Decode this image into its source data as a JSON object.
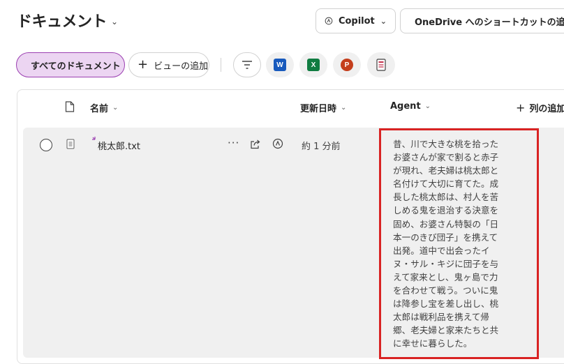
{
  "header": {
    "title": "ドキュメント",
    "copilot_label": "Copilot",
    "onedrive_label": "OneDrive へのショートカットの追加"
  },
  "toolbar": {
    "view_label": "すべてのドキュメント",
    "add_view_label": "ビューの追加",
    "app_icons": [
      "word-icon",
      "excel-icon",
      "powerpoint-icon",
      "forms-icon"
    ]
  },
  "table": {
    "columns": {
      "name": "名前",
      "modified": "更新日時",
      "agent": "Agent",
      "add_column": "列の追加"
    },
    "rows": [
      {
        "file_name": "桃太郎.txt",
        "modified": "約 1 分前",
        "agent": "昔、川で大きな桃を拾ったお婆さんが家で割ると赤子が現れ、老夫婦は桃太郎と名付けて大切に育てた。成長した桃太郎は、村人を苦しめる鬼を退治する決意を固め、お婆さん特製の「日本一のきび団子」を携えて出発。道中で出会ったイヌ・サル・キジに団子を与えて家来とし、鬼ヶ島で力を合わせて戦う。ついに鬼は降参し宝を差し出し、桃太郎は戦利品を携えて帰郷、老夫婦と家来たちと共に幸せに暮らした。"
      }
    ]
  },
  "colors": {
    "accent": "#9b3fb1",
    "active_chip_bg": "#ecd5f2",
    "highlight_border": "#d92323",
    "row_bg": "#f0f0f0"
  }
}
